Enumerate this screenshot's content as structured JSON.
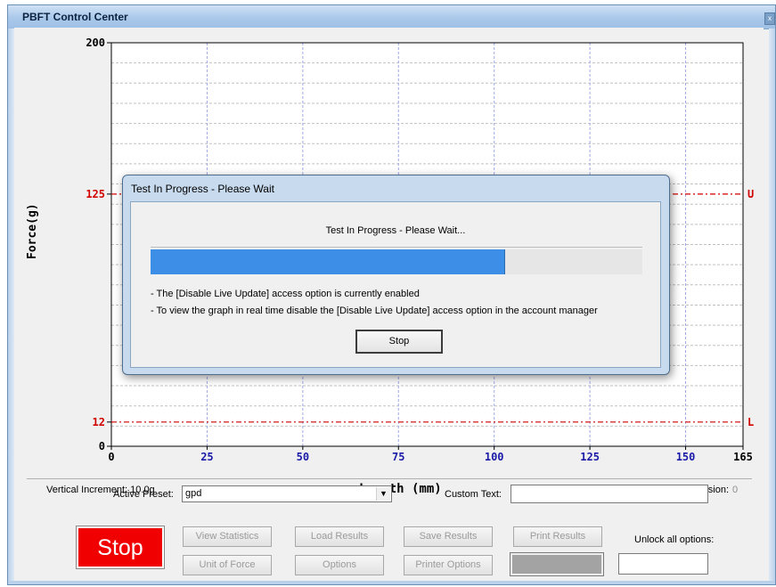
{
  "window": {
    "title": "PBFT Control Center",
    "close_glyph": "x"
  },
  "chart_data": {
    "type": "line",
    "xlabel": "Length (mm)",
    "ylabel": "Force(g)",
    "xlim": [
      0,
      165
    ],
    "ylim": [
      0,
      200
    ],
    "x_ticks": [
      {
        "label": "0",
        "value": 0
      },
      {
        "label": "25",
        "value": 25
      },
      {
        "label": "50",
        "value": 50
      },
      {
        "label": "75",
        "value": 75
      },
      {
        "label": "100",
        "value": 100
      },
      {
        "label": "125",
        "value": 125
      },
      {
        "label": "150",
        "value": 150
      },
      {
        "label": "165",
        "value": 165
      }
    ],
    "y_ticks": [
      {
        "label": "0",
        "value": 0
      },
      {
        "label": "12",
        "value": 12
      },
      {
        "label": "125",
        "value": 125
      },
      {
        "label": "200",
        "value": 200
      }
    ],
    "upper_limit": {
      "value": 125,
      "label": "U",
      "color": "#d00000"
    },
    "lower_limit": {
      "value": 12,
      "label": "L",
      "color": "#d00000"
    },
    "grid": true,
    "series": []
  },
  "chart_info": {
    "vertical_increment": "Vertical Increment: 10.0g",
    "data_version_label": "Data Version:",
    "data_version_value": "0"
  },
  "dialog": {
    "title": "Test In Progress - Please Wait",
    "message": "Test In Progress - Please Wait...",
    "progress": 0.72,
    "notes": [
      "- The [Disable Live Update] access option is currently enabled",
      "- To view the graph in real time disable the [Disable Live Update] access option in the account manager"
    ],
    "stop_label": "Stop"
  },
  "controls": {
    "active_preset_label": "Active Preset:",
    "active_preset_value": "gpd",
    "custom_text_label": "Custom Text:",
    "custom_text_value": "",
    "stop_label": "Stop",
    "view_statistics": "View Statistics",
    "load_results": "Load Results",
    "save_results": "Save Results",
    "print_results": "Print Results",
    "unit_of_force": "Unit of Force",
    "options": "Options",
    "printer_options": "Printer Options",
    "unlock_label": "Unlock all options:",
    "unlock_value": ""
  },
  "colors": {
    "accent_blue": "#3d8ee6",
    "stop_red": "#f00000",
    "tick_blue": "#1a1aa8",
    "limit_red": "#d00000"
  }
}
